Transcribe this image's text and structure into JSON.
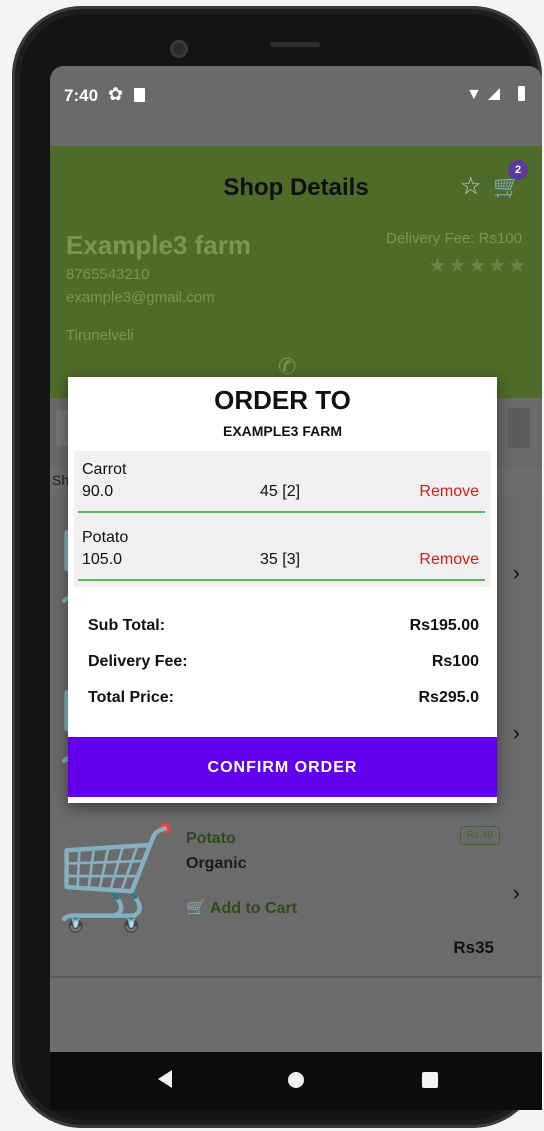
{
  "status_bar": {
    "time": "7:40"
  },
  "header": {
    "title": "Shop Details",
    "cart_badge": "2",
    "farm_name": "Example3 farm",
    "phone": "8765543210",
    "email": "example3@gmail.com",
    "city": "Tirunelveli",
    "delivery_fee": "Delivery Fee: Rs100",
    "rating": "★★★★★"
  },
  "shop_label": "Sho",
  "bottom_card": {
    "name": "Potato",
    "type": "Organic",
    "add_to_cart": "Add to Cart",
    "price_tag": "Rs.40",
    "price": "Rs35"
  },
  "dialog": {
    "title": "ORDER TO",
    "subtitle": "EXAMPLE3 FARM",
    "items": [
      {
        "name": "Carrot",
        "price": "90.0",
        "qty": "45 [2]",
        "remove": "Remove"
      },
      {
        "name": "Potato",
        "price": "105.0",
        "qty": "35 [3]",
        "remove": "Remove"
      }
    ],
    "sub_total_label": "Sub Total:",
    "sub_total_value": "Rs195.00",
    "delivery_label": "Delivery Fee:",
    "delivery_value": "Rs100",
    "total_label": "Total Price:",
    "total_value": "Rs295.0",
    "confirm_label": "CONFIRM ORDER"
  },
  "icons": [
    "gear-icon",
    "sd-card-icon",
    "wifi-icon",
    "signal-icon",
    "battery-icon",
    "star-icon",
    "cart-icon",
    "call-icon",
    "back-icon",
    "home-icon",
    "recents-icon"
  ],
  "colors": {
    "accent": "#6200ee",
    "header_green": "#4e6b29",
    "remove_red": "#d21b1b"
  }
}
